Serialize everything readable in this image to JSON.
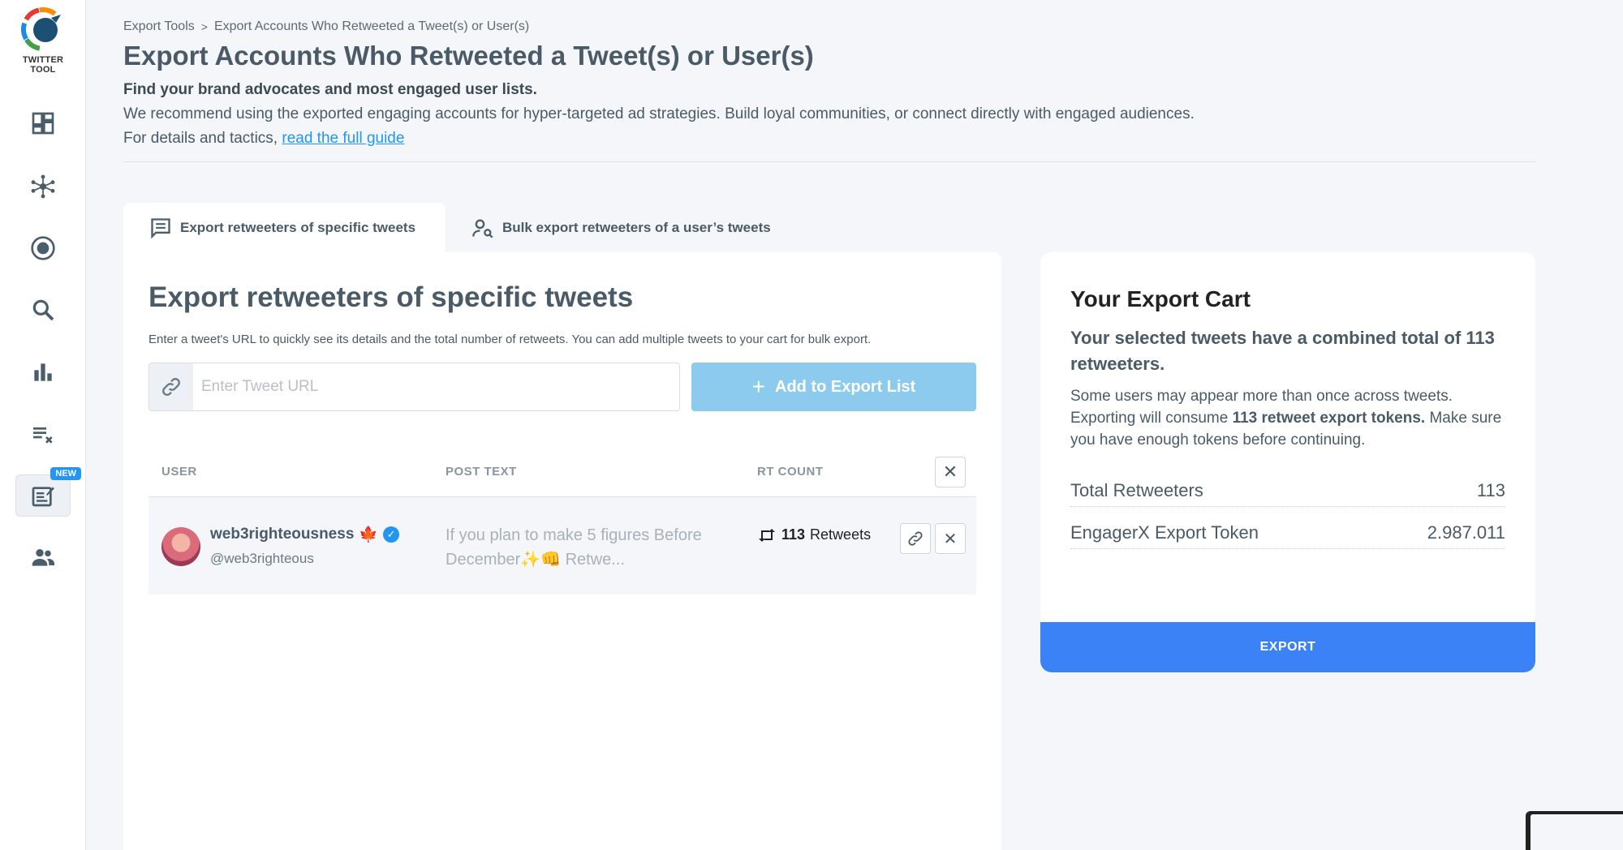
{
  "sidebar": {
    "logo_text": "TWITTER TOOL",
    "items": [
      {
        "name": "dashboard-icon"
      },
      {
        "name": "network-icon"
      },
      {
        "name": "target-icon"
      },
      {
        "name": "search-icon"
      },
      {
        "name": "bar-chart-icon"
      },
      {
        "name": "list-remove-icon"
      },
      {
        "name": "export-icon",
        "badge": "NEW"
      },
      {
        "name": "users-icon"
      }
    ]
  },
  "breadcrumb": {
    "root": "Export Tools",
    "separator": ">",
    "current": "Export Accounts Who Retweeted a Tweet(s) or User(s)"
  },
  "header": {
    "title": "Export Accounts Who Retweeted a Tweet(s) or User(s)",
    "subtitle": "Find your brand advocates and most engaged user lists.",
    "description": "We recommend using the exported engaging accounts for hyper-targeted ad strategies. Build loyal communities, or connect directly with engaged audiences.",
    "guide_prefix": "For details and tactics, ",
    "guide_link": "read the full guide"
  },
  "tabs": [
    {
      "label": "Export retweeters of specific tweets",
      "active": true
    },
    {
      "label": "Bulk export retweeters of a user’s tweets",
      "active": false
    }
  ],
  "main": {
    "title": "Export retweeters of specific tweets",
    "description": "Enter a tweet's URL to quickly see its details and the total number of retweets. You can add multiple tweets to your cart for bulk export.",
    "url_placeholder": "Enter Tweet URL",
    "add_button": "Add to Export List",
    "columns": [
      "USER",
      "POST TEXT",
      "RT COUNT"
    ],
    "rows": [
      {
        "display_name": "web3righteousness",
        "emoji": "🍁",
        "handle": "@web3righteous",
        "post_text": "If you plan to make 5 figures Before December✨👊 Retwe...",
        "rt_count": "113",
        "rt_suffix": "Retweets"
      }
    ]
  },
  "cart": {
    "title": "Your Export Cart",
    "subtitle": "Your selected tweets have a combined total of 113 retweeters.",
    "note_start": "Some users may appear more than once across tweets. Exporting will consume ",
    "note_bold": "113 retweet export tokens.",
    "note_end": " Make sure you have enough tokens before continuing.",
    "total_label": "Total Retweeters",
    "total_value": "113",
    "token_label": "EngagerX Export Token",
    "token_value": "2.987.011",
    "export_button": "EXPORT"
  },
  "colors": {
    "accent": "#3b82f6",
    "add_button": "#8ccbee",
    "link": "#2196f3",
    "badge": "#2196f3"
  }
}
